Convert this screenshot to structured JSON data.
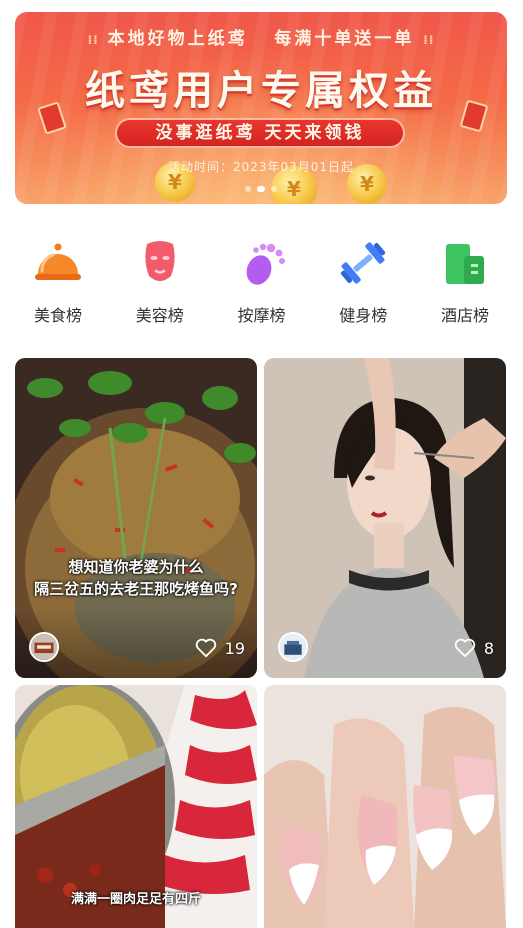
{
  "banner": {
    "top_line_left": "本地好物上纸鸢",
    "top_line_right": "每满十单送一单",
    "headline": "纸鸢用户专属权益",
    "pill_text": "没事逛纸鸢  天天来领钱",
    "activity_time": "活动时间：2023年03月01日起",
    "coin_symbol": "¥",
    "slide_count": 3,
    "active_slide": 2
  },
  "categories": [
    {
      "label": "美食榜",
      "icon": "food-cloche-icon",
      "color": "#f5892a"
    },
    {
      "label": "美容榜",
      "icon": "face-mask-icon",
      "color": "#f45b6a"
    },
    {
      "label": "按摩榜",
      "icon": "foot-icon",
      "color": "#b55cf0"
    },
    {
      "label": "健身榜",
      "icon": "dumbbell-icon",
      "color": "#3f7ef5"
    },
    {
      "label": "酒店榜",
      "icon": "hotel-building-icon",
      "color": "#3ec45e"
    }
  ],
  "feed": [
    {
      "caption": "想知道你老婆为什么\n隔三岔五的去老王那吃烤鱼吗?",
      "likes": "19",
      "image": "grilled-fish-photo",
      "avatar": "restaurant-avatar"
    },
    {
      "caption": "",
      "likes": "8",
      "image": "haircut-photo",
      "avatar": "salon-avatar"
    },
    {
      "caption": "满满一圈肉足足有四斤",
      "likes": "",
      "image": "hotpot-photo"
    },
    {
      "caption": "",
      "likes": "",
      "image": "manicure-photo"
    }
  ],
  "colors": {
    "banner_red": "#f0574a",
    "text_dark": "#333333"
  }
}
